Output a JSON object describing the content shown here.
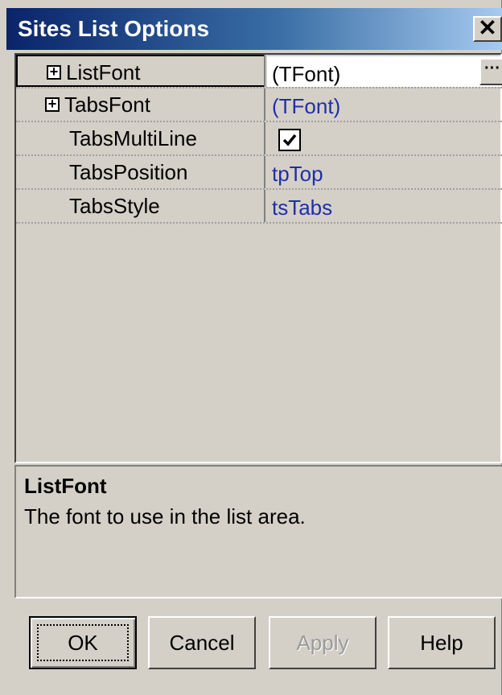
{
  "window": {
    "title": "Sites List Options",
    "close_glyph": "✕"
  },
  "properties": [
    {
      "name": "ListFont",
      "value": "(TFont)",
      "expandable": true,
      "selected": true
    },
    {
      "name": "TabsFont",
      "value": "(TFont)",
      "expandable": true,
      "selected": false
    },
    {
      "name": "TabsMultiLine",
      "value": "",
      "checked": true,
      "selected": false
    },
    {
      "name": "TabsPosition",
      "value": "tpTop",
      "selected": false
    },
    {
      "name": "TabsStyle",
      "value": "tsTabs",
      "selected": false
    }
  ],
  "expander_glyph": "+",
  "ellipsis_glyph": "···",
  "description": {
    "title": "ListFont",
    "text": "The font to use in the list area."
  },
  "buttons": {
    "ok": "OK",
    "cancel": "Cancel",
    "apply": "Apply",
    "help": "Help"
  },
  "colors": {
    "titlebar_start": "#0a246a",
    "titlebar_end": "#a6caf0",
    "value_text": "#1f2fa8",
    "face": "#d4d0c8"
  }
}
